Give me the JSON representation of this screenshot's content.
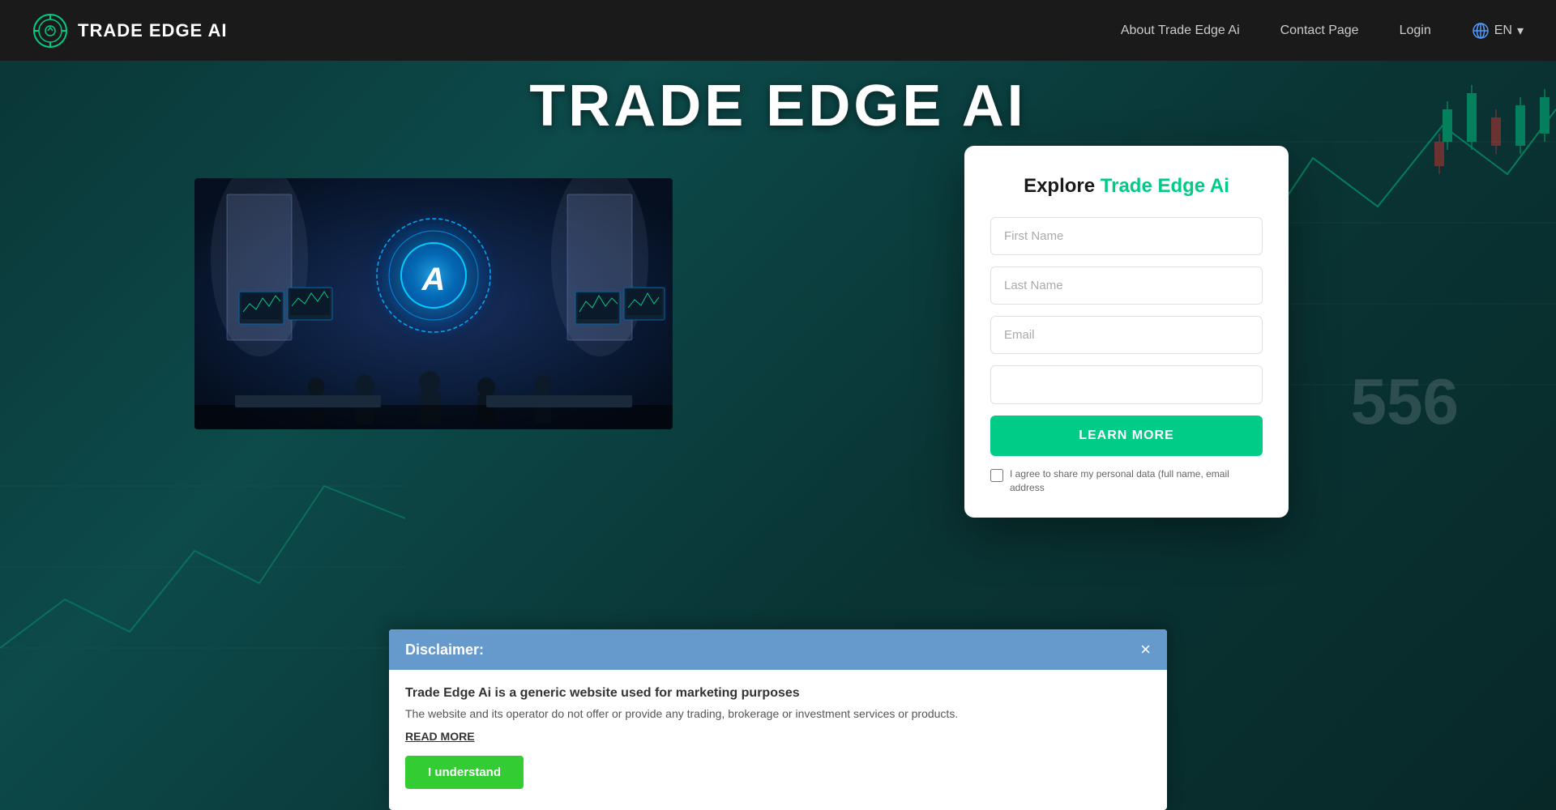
{
  "navbar": {
    "logo_text": "TRADE EDGE AI",
    "links": [
      {
        "label": "About Trade Edge Ai",
        "id": "about"
      },
      {
        "label": "Contact Page",
        "id": "contact"
      },
      {
        "label": "Login",
        "id": "login"
      }
    ],
    "lang_label": "EN",
    "lang_icon": "globe"
  },
  "hero": {
    "title": "TRADE EDGE AI"
  },
  "form": {
    "title_part1": "Explore ",
    "title_part2": "Trade Edge Ai",
    "first_name_placeholder": "First Name",
    "last_name_placeholder": "Last Name",
    "email_placeholder": "Email",
    "phone_placeholder": "",
    "learn_more_label": "LEARN MORE",
    "consent_text": "I agree to share my personal data (full name, email address"
  },
  "disclaimer": {
    "title": "Disclaimer:",
    "main_text": "Trade Edge Ai is a generic website used for marketing purposes",
    "sub_text": "The website and its operator do not offer or provide any trading, brokerage or investment services or products.",
    "read_more_label": "READ MORE",
    "understand_label": "I understand"
  },
  "bg_number": "556"
}
